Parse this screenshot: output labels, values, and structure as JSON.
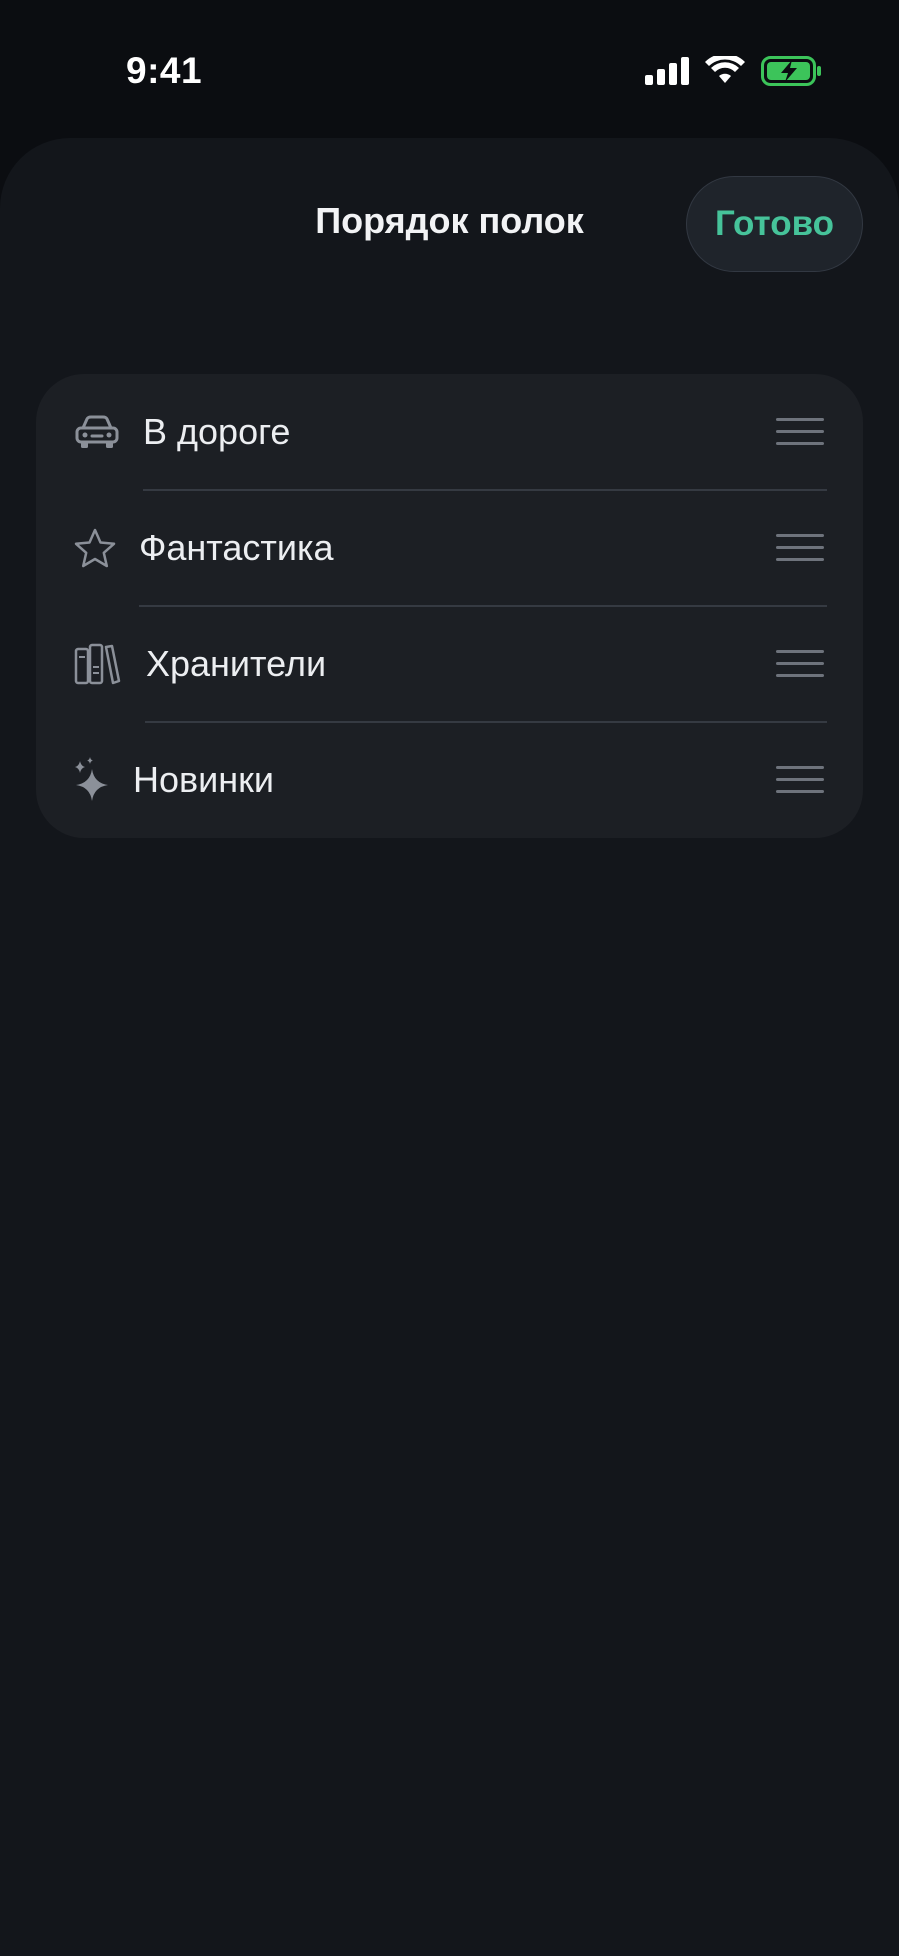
{
  "status_bar": {
    "time": "9:41",
    "icons": [
      "cellular-signal-icon",
      "wifi-icon",
      "battery-charging-icon"
    ]
  },
  "sheet": {
    "title": "Порядок полок",
    "done_label": "Готово"
  },
  "shelves": [
    {
      "label": "В дороге",
      "icon": "car-icon"
    },
    {
      "label": "Фантастика",
      "icon": "star-icon"
    },
    {
      "label": "Хранители",
      "icon": "books-icon"
    },
    {
      "label": "Новинки",
      "icon": "sparkles-icon"
    }
  ],
  "colors": {
    "accent": "#46c39a",
    "sheet_background": "#13161b",
    "card_background": "#1c1f24",
    "battery_green": "#3cc45a",
    "icon_gray": "#8b9099"
  }
}
